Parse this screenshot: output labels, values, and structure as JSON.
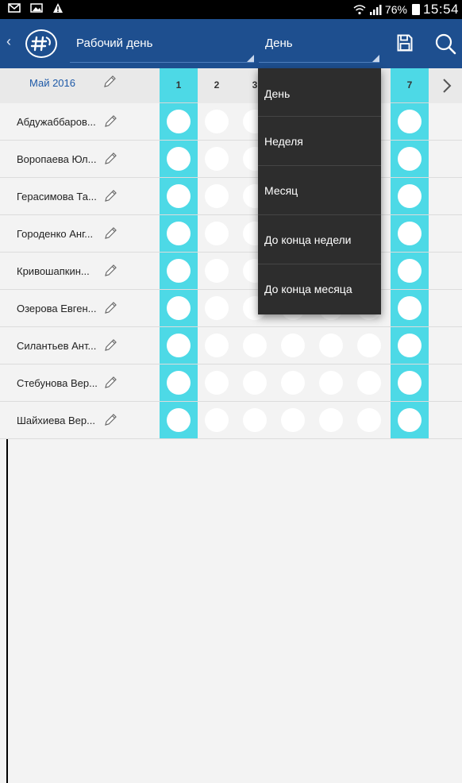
{
  "status_bar": {
    "battery": "76%",
    "clock": "15:54",
    "icons": [
      "mail-icon",
      "photo-icon",
      "warning-icon",
      "wifi-icon",
      "signal-icon",
      "battery-icon"
    ]
  },
  "app_bar": {
    "back_glyph": "‹",
    "title": "Рабочий день",
    "view_selected": "День",
    "colors": {
      "bar": "#1e4f8f",
      "accent": "#4dd9e6"
    }
  },
  "grid": {
    "month": "Май 2016",
    "days": [
      "1",
      "2",
      "3",
      "7"
    ],
    "employees": [
      "Абдужаббаров...",
      "Воропаева Юл...",
      "Герасимова Та...",
      "Городенко Анг...",
      "Кривошапкин...",
      "Озерова Евген...",
      "Силантьев Ант...",
      "Стебунова Вер...",
      "Шайхиева Вер..."
    ]
  },
  "dropdown": {
    "options": [
      "День",
      "Неделя",
      "Месяц",
      "До конца недели",
      "До конца месяца"
    ]
  }
}
